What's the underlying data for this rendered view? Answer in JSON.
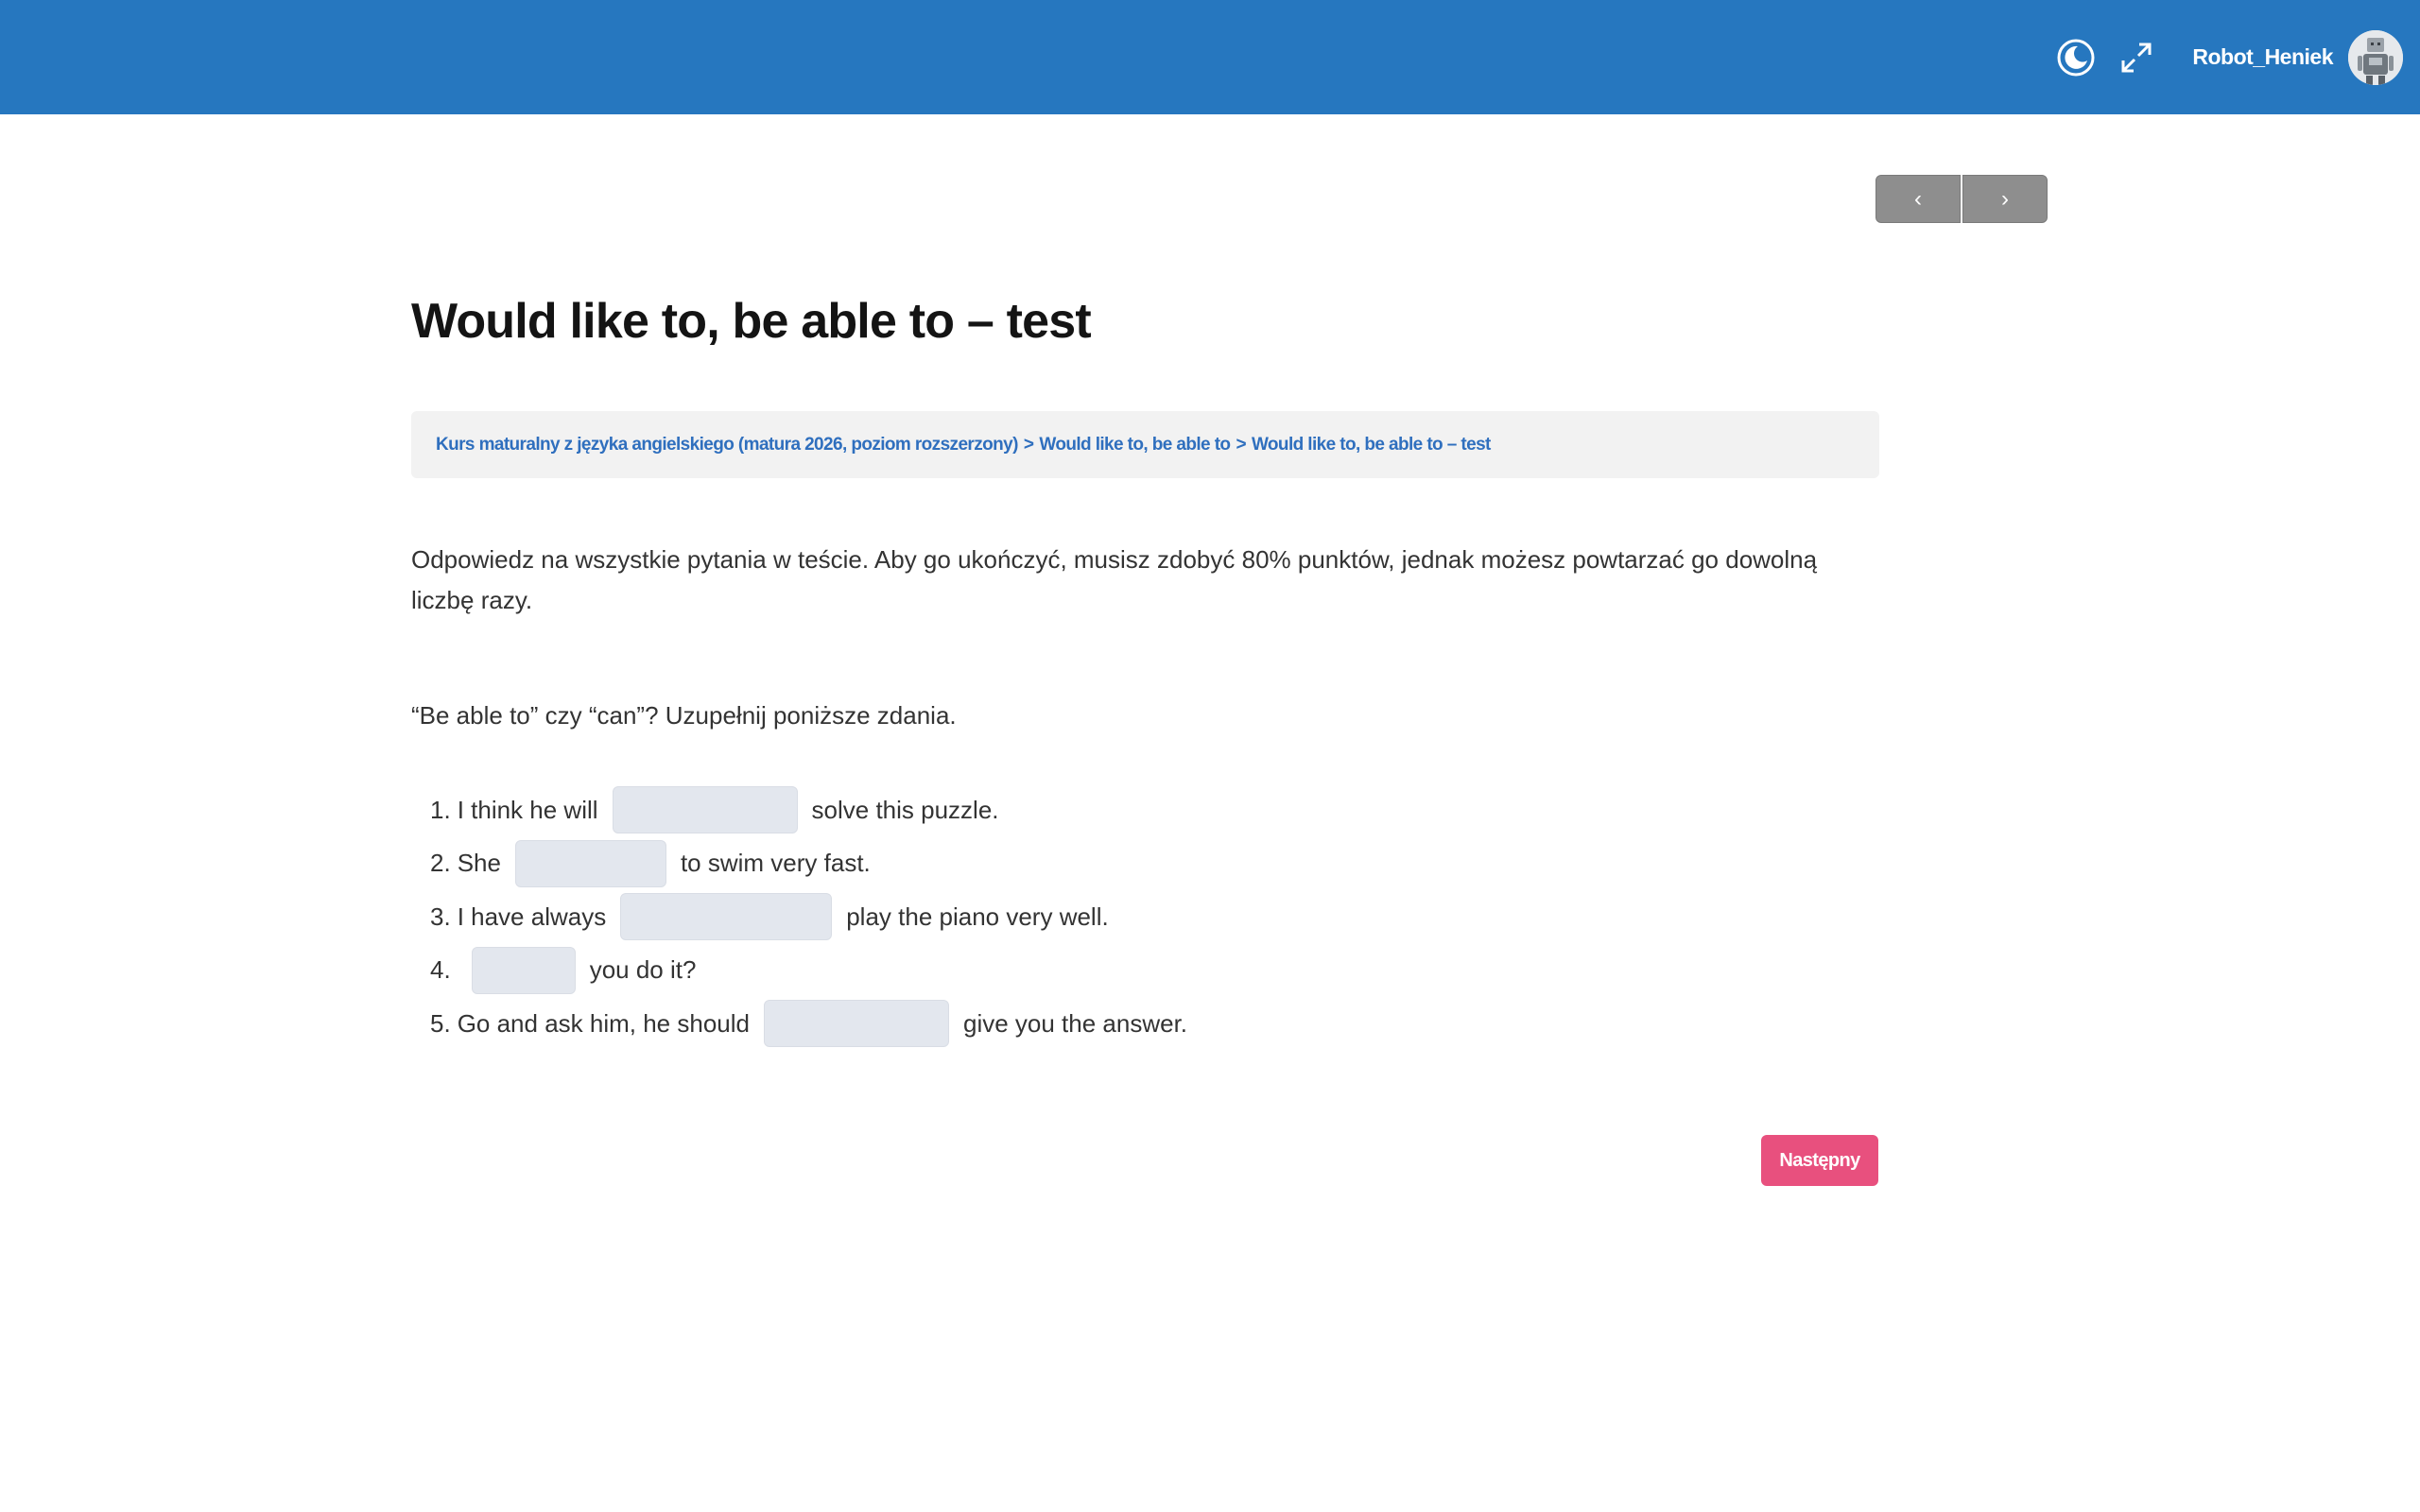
{
  "header": {
    "username": "Robot_Heniek",
    "brand_color": "#2677bf",
    "icons": [
      "moon-icon",
      "expand-icon"
    ]
  },
  "pager": {
    "prev_label": "‹",
    "next_label": "›"
  },
  "page": {
    "title": "Would like to, be able to – test"
  },
  "breadcrumb": {
    "items": [
      "Kurs maturalny z języka angielskiego (matura 2026, poziom rozszerzony)",
      "Would like to, be able to",
      "Would like to, be able to – test"
    ],
    "separator": ">"
  },
  "instructions": "Odpowiedz na wszystkie pytania w teście. Aby go ukończyć, musisz zdobyć 80% punktów, jednak możesz powtarzać go dowolną liczbę razy.",
  "question": "“Be able to” czy “can”? Uzupełnij poniższe zdania.",
  "exercise": {
    "items": [
      {
        "number": "1.",
        "before": "I think he will",
        "after": "solve this puzzle.",
        "value": ""
      },
      {
        "number": "2.",
        "before": "She",
        "after": "to swim very fast.",
        "value": ""
      },
      {
        "number": "3.",
        "before": "I have always",
        "after": "play the piano very well.",
        "value": ""
      },
      {
        "number": "4.",
        "before": "",
        "after": "you do it?",
        "value": ""
      },
      {
        "number": "5.",
        "before": "Go and ask him, he should",
        "after": "give you the answer.",
        "value": ""
      }
    ]
  },
  "actions": {
    "next_label": "Następny",
    "next_color": "#e8507e"
  }
}
